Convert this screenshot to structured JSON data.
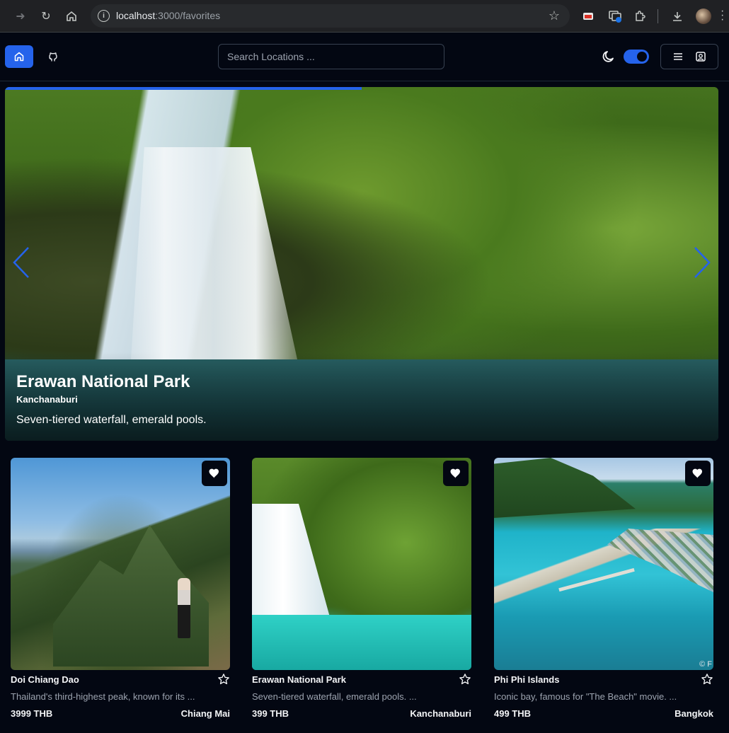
{
  "browser": {
    "url_host": "localhost",
    "url_path": ":3000/favorites"
  },
  "nav": {
    "search_placeholder": "Search Locations ..."
  },
  "hero": {
    "title": "Erawan National Park",
    "location": "Kanchanaburi",
    "description": "Seven-tiered waterfall, emerald pools.",
    "progress": 0.5
  },
  "cards": [
    {
      "name": "Doi Chiang Dao",
      "description": "Thailand's third-highest peak, known for its ...",
      "price": "3999 THB",
      "province": "Chiang Mai",
      "favorite": true
    },
    {
      "name": "Erawan National Park",
      "description": "Seven-tiered waterfall, emerald pools. ...",
      "price": "399 THB",
      "province": "Kanchanaburi",
      "favorite": true
    },
    {
      "name": "Phi Phi Islands",
      "description": "Iconic bay, famous for \"The Beach\" movie. ...",
      "price": "499 THB",
      "province": "Bangkok",
      "favorite": true,
      "image_credit": "© F"
    }
  ],
  "colors": {
    "accent": "#2563eb",
    "background": "#030712"
  }
}
